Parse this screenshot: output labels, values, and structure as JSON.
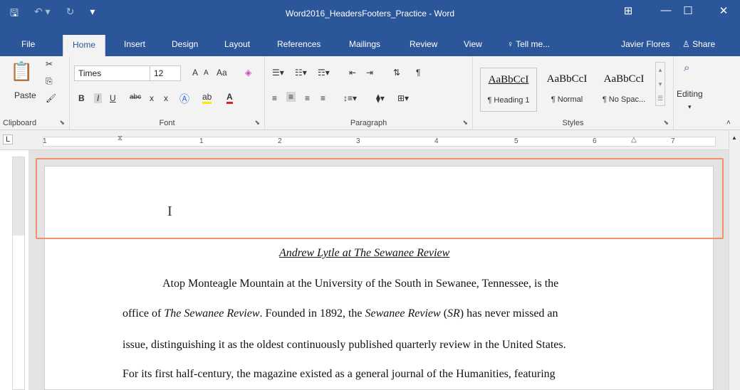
{
  "window": {
    "title": "Word2016_HeadersFooters_Practice - Word",
    "restore_icon": "ribbon-display-icon"
  },
  "tabs": [
    "File",
    "Home",
    "Insert",
    "Design",
    "Layout",
    "References",
    "Mailings",
    "Review",
    "View"
  ],
  "active_tab": "Home",
  "tell_me": "Tell me...",
  "user": "Javier Flores",
  "share": "Share",
  "clipboard": {
    "paste": "Paste",
    "label": "Clipboard"
  },
  "font": {
    "name": "Times",
    "size": "12",
    "grow": "A",
    "shrink": "A",
    "case": "Aa",
    "bold": "B",
    "italic": "I",
    "underline": "U",
    "strike": "abc",
    "sub": "x",
    "sup": "x",
    "label": "Font"
  },
  "paragraph": {
    "label": "Paragraph",
    "pilcrow": "¶"
  },
  "styles": {
    "label": "Styles",
    "preview": "AaBbCcI",
    "items": [
      "¶ Heading 1",
      "¶ Normal",
      "¶ No Spac..."
    ]
  },
  "editing": {
    "label": "Editing"
  },
  "ruler": {
    "numbers": [
      "1",
      "1",
      "2",
      "3",
      "4",
      "5",
      "6",
      "7"
    ],
    "tab_marker": "L"
  },
  "document": {
    "title": "Andrew Lytle at The Sewanee Review",
    "line1": "Atop Monteagle Mountain at the University of the South in Sewanee, Tennessee, is the",
    "line2a": "office of ",
    "line2b": "The Sewanee Review",
    "line2c": ". Founded in 1892, the ",
    "line2d": "Sewanee Review",
    "line2e": " (",
    "line2f": "SR",
    "line2g": ") has never missed an",
    "line3": "issue, distinguishing it as the oldest continuously published quarterly review in the United States.",
    "line4": "For its first half-century, the magazine existed as a general journal of the Humanities, featuring"
  },
  "colors": {
    "brand": "#2b579a",
    "highlight": "#f0906e"
  }
}
